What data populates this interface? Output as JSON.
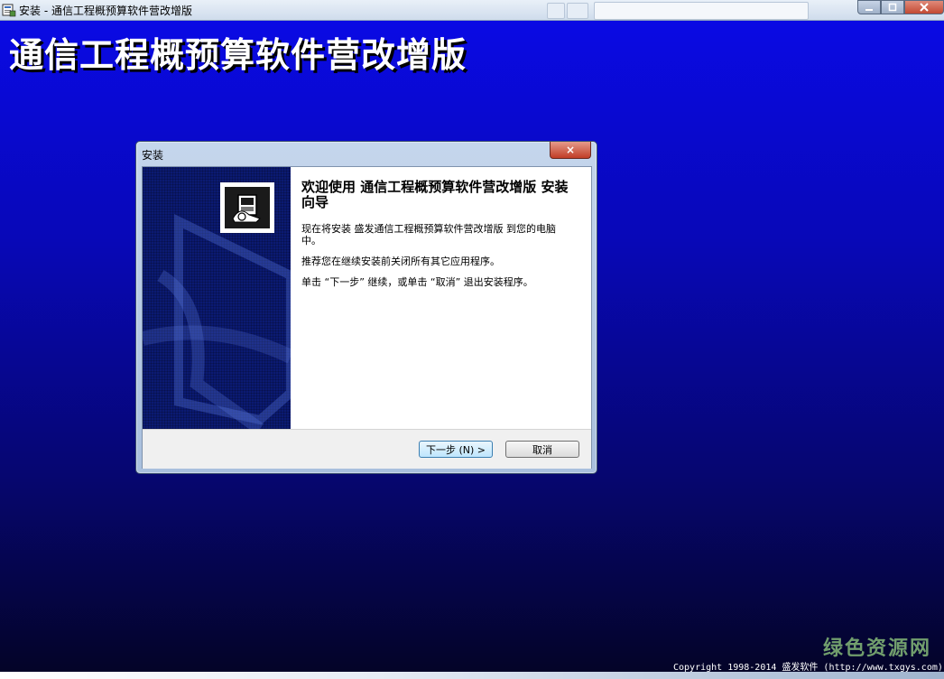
{
  "window": {
    "title": "安装 - 通信工程概预算软件营改增版"
  },
  "banner_title": "通信工程概预算软件营改增版",
  "dialog": {
    "title": "安装",
    "close_symbol": "×",
    "welcome_title": "欢迎使用 通信工程概预算软件营改增版 安装向导",
    "paragraphs": [
      "现在将安装 盛发通信工程概预算软件营改增版 到您的电脑中。",
      "推荐您在继续安装前关闭所有其它应用程序。",
      "单击 “下一步” 继续，或单击 “取消” 退出安装程序。"
    ],
    "buttons": {
      "next": "下一步 (N) >",
      "cancel": "取消"
    }
  },
  "footer": {
    "copyright": "Copyright 1998-2014 盛发软件 (http://www.txgys.com)"
  },
  "watermark": "绿色资源网",
  "colors": {
    "background_top": "#0a0ae8",
    "background_bottom": "#040425",
    "banner": "#0b1a72"
  },
  "icons": {
    "app": "installer-icon",
    "product": "computer-disk-icon",
    "close": "close-icon"
  }
}
